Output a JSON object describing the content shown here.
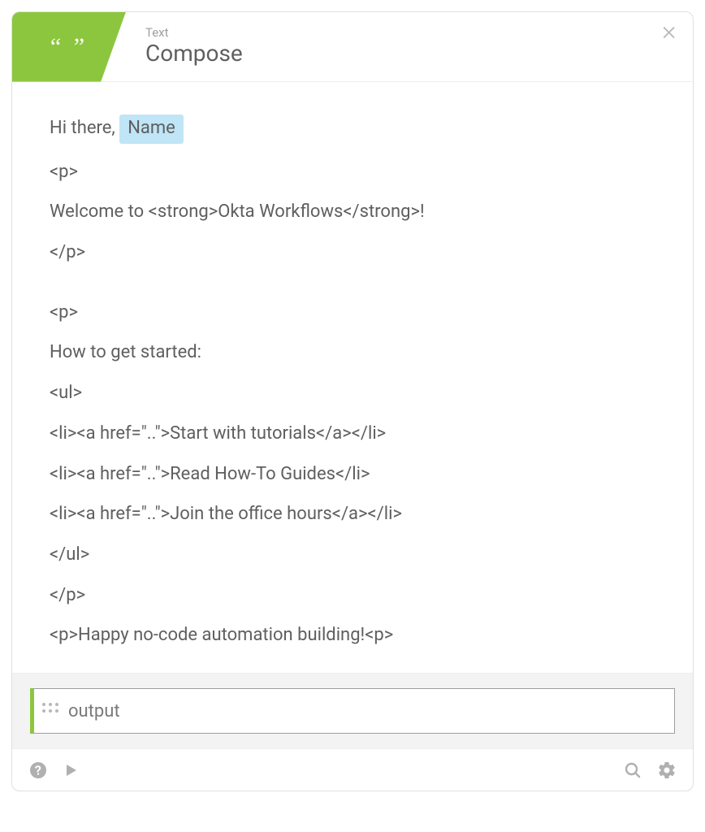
{
  "header": {
    "kicker": "Text",
    "title": "Compose",
    "quote_glyph": "“  ”"
  },
  "body": {
    "greeting_prefix": "Hi there, ",
    "greeting_token": "Name",
    "lines": [
      "<p>",
      "Welcome to <strong>Okta Workflows</strong>!",
      "</p>",
      "",
      "<p>",
      "How to get started:",
      "<ul>",
      " <li><a href=\"..\">Start with tutorials</a></li>",
      "<li><a href=\"..\">Read How-To Guides</li>",
      "<li><a href=\"..\">Join the office hours</a></li>",
      "</ul>",
      "</p>",
      "<p>Happy no-code automation building!<p>"
    ]
  },
  "output": {
    "label": "output"
  },
  "colors": {
    "accent": "#8cc63f",
    "token_bg": "#bfe5f6"
  }
}
